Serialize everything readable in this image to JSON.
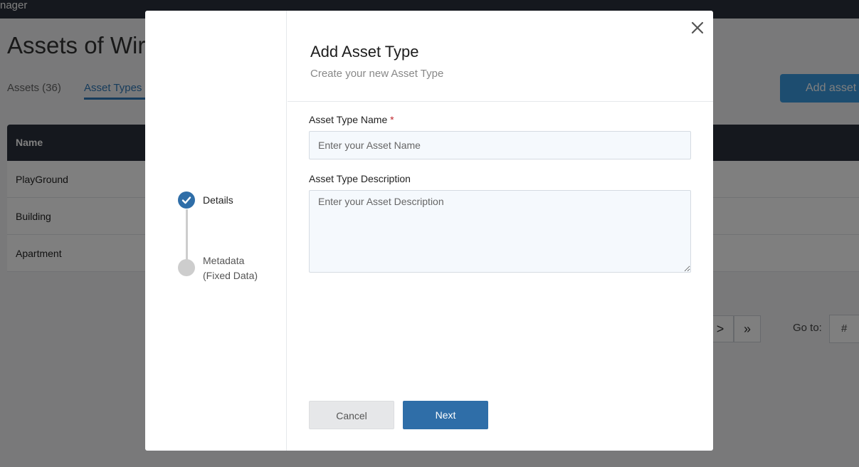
{
  "background": {
    "app_title": "nager",
    "page_title": "Assets of Wir",
    "tabs": [
      {
        "label": "Assets (36)"
      },
      {
        "label": "Asset Types ("
      }
    ],
    "add_button_label": "Add asset",
    "table": {
      "header": "Name",
      "rows": [
        "PlayGround",
        "Building",
        "Apartment"
      ]
    },
    "pager": {
      "next_symbol": ">",
      "last_symbol": "»",
      "goto_label": "Go to:",
      "goto_placeholder": "#"
    }
  },
  "modal": {
    "title": "Add Asset Type",
    "subtitle": "Create your new Asset Type",
    "steps": [
      {
        "label": "Details",
        "status": "done"
      },
      {
        "label_line1": "Metadata",
        "label_line2": "(Fixed Data)",
        "status": "pending"
      }
    ],
    "fields": {
      "name": {
        "label": "Asset Type Name",
        "required_mark": "*",
        "placeholder": "Enter your Asset Name"
      },
      "description": {
        "label": "Asset Type Description",
        "placeholder": "Enter your Asset Description"
      }
    },
    "buttons": {
      "cancel": "Cancel",
      "next": "Next"
    },
    "colors": {
      "primary": "#2f6ea8",
      "required": "#c0262d"
    }
  }
}
